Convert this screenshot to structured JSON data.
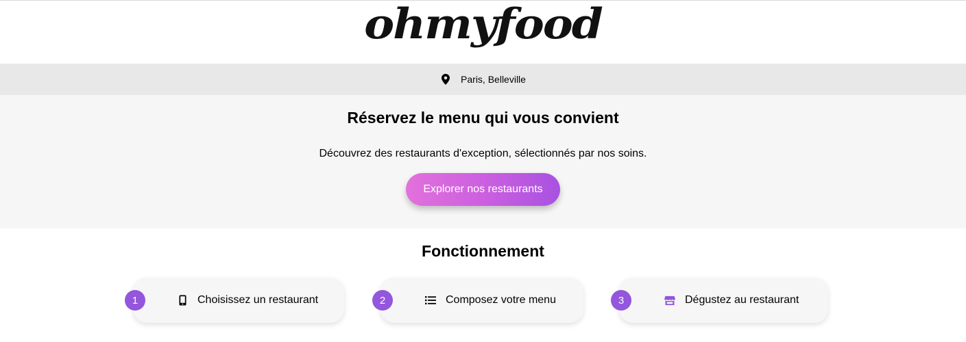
{
  "header": {
    "logo_text": "ohmyfood"
  },
  "location": {
    "icon": "map-pin-icon",
    "text": "Paris, Belleville"
  },
  "hero": {
    "title": "Réservez le menu qui vous convient",
    "subtitle": "Découvrez des restaurants d'exception, sélectionnés par nos soins.",
    "cta_label": "Explorer nos restaurants"
  },
  "how_it_works": {
    "title": "Fonctionnement",
    "steps": [
      {
        "number": "1",
        "icon": "mobile-phone-icon",
        "label": "Choisissez un restaurant"
      },
      {
        "number": "2",
        "icon": "list-icon",
        "label": "Composez votre menu"
      },
      {
        "number": "3",
        "icon": "store-icon",
        "label": "Dégustez au restaurant"
      }
    ]
  },
  "colors": {
    "accent_purple": "#9356dc",
    "cta_gradient_start": "#e271dc",
    "cta_gradient_end": "#a852e1",
    "location_bar_bg": "#e8e8e8",
    "hero_bg": "#f6f6f6"
  }
}
